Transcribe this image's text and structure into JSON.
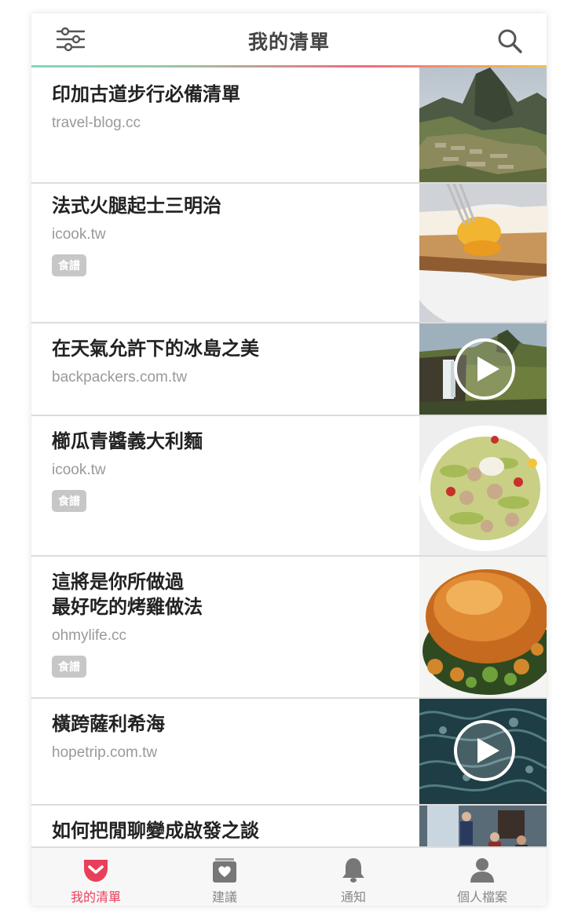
{
  "header": {
    "title": "我的清單",
    "filter_icon": "sliders-icon",
    "search_icon": "search-icon"
  },
  "colors": {
    "accent": "#e8405a",
    "tag_bg": "#c7c7c7",
    "rainbow": [
      "#83d7c0",
      "#ef6b80",
      "#f2c24d"
    ]
  },
  "items": [
    {
      "title_lines": [
        "印加古道步行必備清單"
      ],
      "source": "travel-blog.cc",
      "tag": "",
      "thumbnail": "mountain-ruins-photo",
      "video": false
    },
    {
      "title_lines": [
        "法式火腿起士三明治"
      ],
      "source": "icook.tw",
      "tag": "食譜",
      "thumbnail": "croque-madame-photo",
      "video": false
    },
    {
      "title_lines": [
        "在天氣允許下的冰島之美"
      ],
      "source": "backpackers.com.tw",
      "tag": "",
      "thumbnail": "iceland-waterfall-photo",
      "video": true
    },
    {
      "title_lines": [
        "櫛瓜青醬義大利麵"
      ],
      "source": "icook.tw",
      "tag": "食譜",
      "thumbnail": "zucchini-pasta-photo",
      "video": false
    },
    {
      "title_lines": [
        "這將是你所做過",
        "最好吃的烤雞做法"
      ],
      "source": "ohmylife.cc",
      "tag": "食譜",
      "thumbnail": "roast-chicken-photo",
      "video": false
    },
    {
      "title_lines": [
        "橫跨薩利希海"
      ],
      "source": "hopetrip.com.tw",
      "tag": "",
      "thumbnail": "ocean-waves-photo",
      "video": true
    },
    {
      "title_lines": [
        "如何把閒聊變成啟發之談"
      ],
      "source": "",
      "tag": "",
      "thumbnail": "cafe-people-photo",
      "video": false
    }
  ],
  "tabs": [
    {
      "label": "我的清單",
      "icon": "pocket-icon",
      "active": true
    },
    {
      "label": "建議",
      "icon": "heart-card-icon",
      "active": false
    },
    {
      "label": "通知",
      "icon": "bell-icon",
      "active": false
    },
    {
      "label": "個人檔案",
      "icon": "person-icon",
      "active": false
    }
  ]
}
